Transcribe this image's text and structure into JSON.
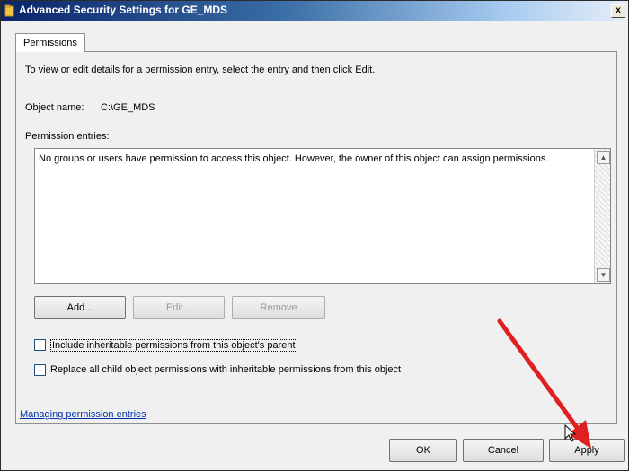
{
  "window": {
    "title": "Advanced Security Settings for GE_MDS",
    "close_label": "x"
  },
  "tab": {
    "label": "Permissions"
  },
  "panel": {
    "instructions": "To view or edit details for a permission entry, select the entry and then click Edit.",
    "object_name_label": "Object name:",
    "object_name_value": "C:\\GE_MDS",
    "entries_label": "Permission entries:",
    "entries_message": "No groups or users have permission to access this object. However, the owner of this object can assign permissions.",
    "buttons": {
      "add": "Add...",
      "edit": "Edit...",
      "remove": "Remove"
    },
    "checkbox_inherit": "Include inheritable permissions from this object's parent",
    "checkbox_replace": "Replace all child object permissions with inheritable permissions from this object",
    "link_managing": "Managing permission entries"
  },
  "footer": {
    "ok": "OK",
    "cancel": "Cancel",
    "apply": "Apply"
  },
  "colors": {
    "arrow": "#e02020",
    "titlebar": "#0a246a"
  }
}
